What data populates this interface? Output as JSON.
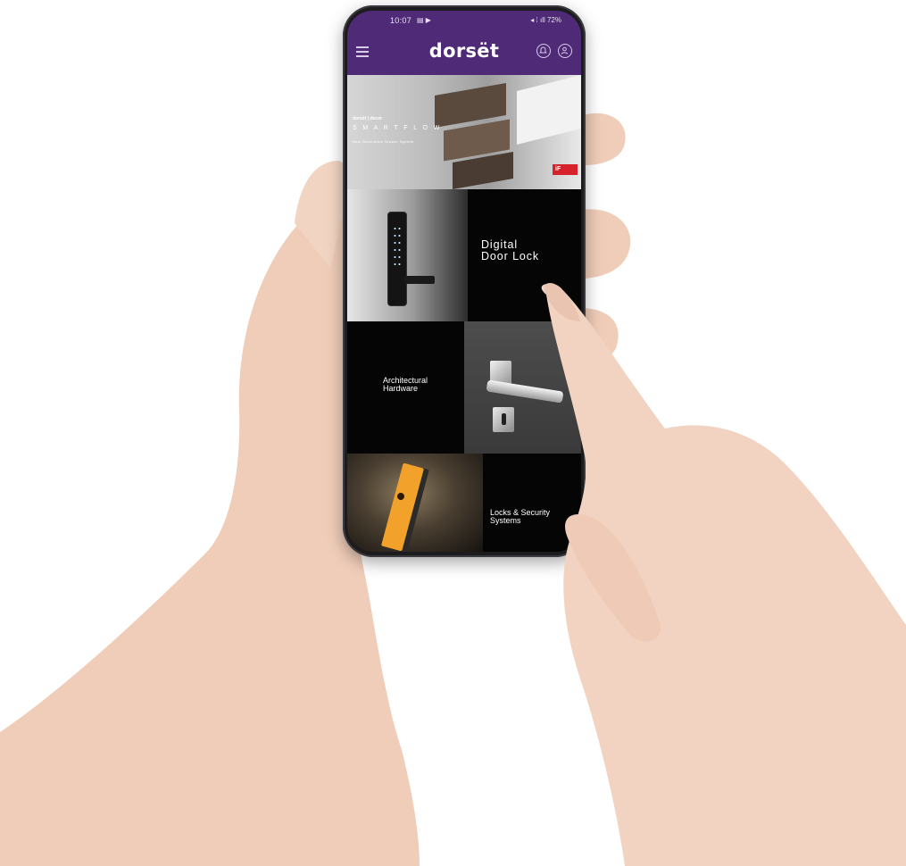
{
  "status_bar": {
    "time": "10:07",
    "notification_icons": "▤ ▶",
    "system_icons": "◂ ⁞ ıll 72%"
  },
  "app_bar": {
    "brand": "dorsët"
  },
  "banner": {
    "brand_line": "dorsët | decor",
    "title": "S M A R T F L O W",
    "subtitle": "New Generation Drawer System",
    "badge": "iF",
    "slides": 4,
    "active_slide": 1
  },
  "tiles": {
    "digital": [
      "Digital",
      "Door Lock"
    ],
    "architectural": [
      "Architectural",
      "Hardware"
    ],
    "locks": [
      "Locks & Security",
      "Systems"
    ]
  }
}
